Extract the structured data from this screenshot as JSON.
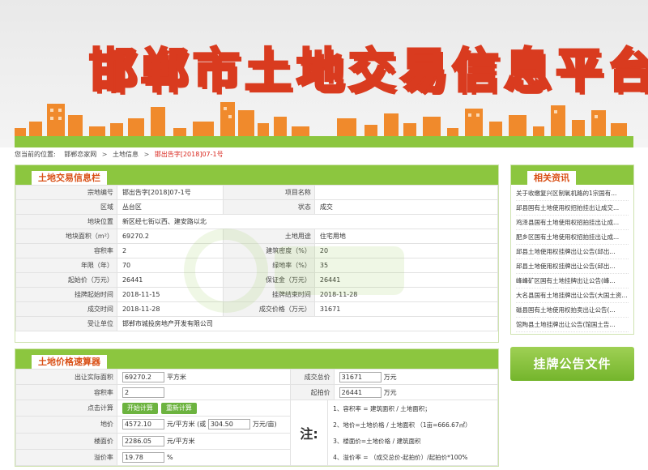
{
  "banner": {
    "title": "邯郸市土地交易信息平台"
  },
  "breadcrumb": {
    "prefix": "您当前的位置:",
    "items": [
      "邯郸恋家网",
      "土地信息"
    ],
    "current": "邯出告字[2018]07-1号",
    "separator": ">"
  },
  "info": {
    "title": "土地交易信息栏",
    "rows": [
      [
        "宗地编号",
        "邯出告字[2018]07-1号",
        "项目名称",
        ""
      ],
      [
        "区域",
        "丛台区",
        "状态",
        "成交"
      ],
      [
        "地块位置",
        "新区经七街以西、建安路以北",
        null,
        null
      ],
      [
        "地块面积（m²）",
        "69270.2",
        "土地用途",
        "住宅用地"
      ],
      [
        "容积率",
        "2",
        "建筑密度（%）",
        "20"
      ],
      [
        "年限（年）",
        "70",
        "绿地率（%）",
        "35"
      ],
      [
        "起始价（万元）",
        "26441",
        "保证金（万元）",
        "26441"
      ],
      [
        "挂牌起始时间",
        "2018-11-15",
        "挂牌结束时间",
        "2018-11-28"
      ],
      [
        "成交时间",
        "2018-11-28",
        "成交价格（万元）",
        "31671"
      ],
      [
        "受让单位",
        "邯郸市城投房地产开发有限公司",
        null,
        null
      ]
    ]
  },
  "calc": {
    "title": "土地价格速算器",
    "area_label": "出让实际面积",
    "area_value": "69270.2",
    "area_unit": "平方米",
    "total_label": "成交总价",
    "total_value": "31671",
    "total_unit": "万元",
    "far_label": "容积率",
    "far_value": "2",
    "start_label": "起拍价",
    "start_value": "26441",
    "start_unit": "万元",
    "click_label": "点击计算",
    "start_btn": "开始计算",
    "reset_btn": "重新计算",
    "land_price_label": "地价",
    "land_price_value": "4572.10",
    "land_price_unit": "元/平方米 (或",
    "land_price_mu_value": "304.50",
    "land_price_mu_unit": "万元/亩)",
    "floor_price_label": "楼面价",
    "floor_price_value": "2286.05",
    "floor_price_unit": "元/平方米",
    "premium_label": "溢价率",
    "premium_value": "19.78",
    "premium_unit": "%",
    "note_mark": "注:",
    "notes": [
      "1、容积率 = 建筑面积 / 土地面积；",
      "2、地价=土地价格 / 土地面积 （1亩=666.67㎡）",
      "3、楼面价=土地价格 / 建筑面积",
      "4、溢价率 = （成交总价-起拍价）/起拍价*100%"
    ]
  },
  "related": {
    "title": "相关资讯",
    "items": [
      "关于收缴复兴区制氧机路的1宗国有...",
      "邱县国有土地使用权招拍挂出让成交...",
      "鸡泽县国有土地使用权招拍挂出让成...",
      "肥乡区国有土地使用权招拍挂出让成...",
      "邱县土地使用权挂牌出让公告(邱出...",
      "邱县土地使用权挂牌出让公告(邱出...",
      "峰峰矿区国有土地挂牌出让公告(峰...",
      "大名县国有土地挂牌出让公告(大国土资...",
      "磁县国有土地使用权拍卖出让公告(...",
      "馆陶县土地挂牌出让公告(馆国土告..."
    ]
  },
  "notice_button": "挂牌公告文件",
  "colors": {
    "green": "#8cc63f",
    "orange": "#f08a2c",
    "red": "#d9251c"
  }
}
